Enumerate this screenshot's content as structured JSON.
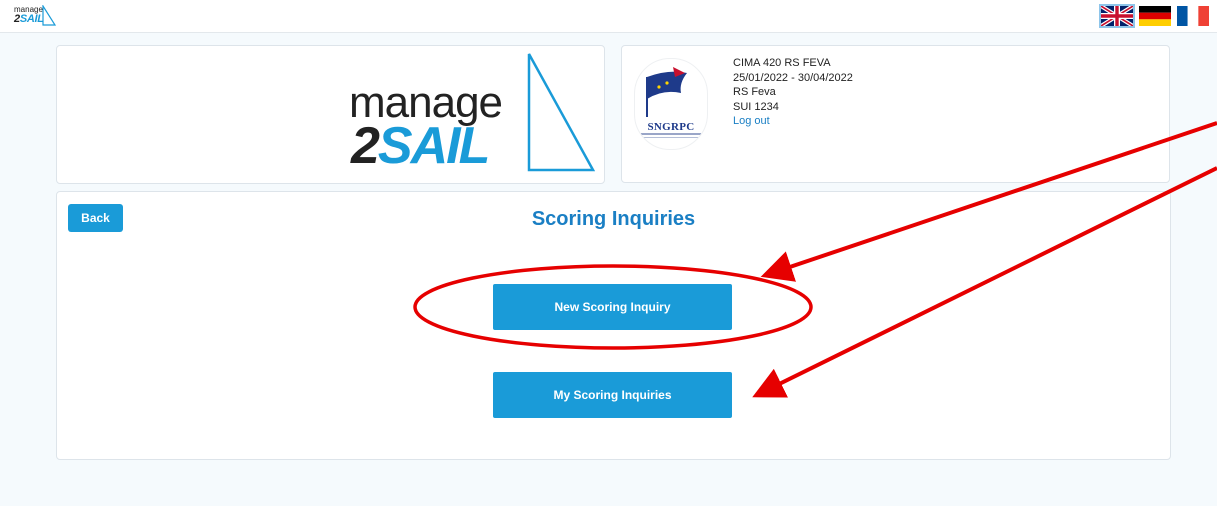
{
  "header": {
    "mini_logo": {
      "line1": "manage",
      "line2_dark": "2",
      "line2_blue": "SAIL"
    },
    "languages": [
      {
        "code": "en",
        "name": "English"
      },
      {
        "code": "de",
        "name": "Deutsch"
      },
      {
        "code": "fr",
        "name": "Français"
      }
    ]
  },
  "brand": {
    "line1": "manage",
    "line2_dark": "2",
    "line2_blue": "SAIL"
  },
  "event": {
    "club_logo_text": "SNGRPC",
    "name": "CIMA 420 RS FEVA",
    "dates": "25/01/2022 - 30/04/2022",
    "class": "RS Feva",
    "sail_number": "SUI 1234",
    "logout_label": "Log out"
  },
  "page": {
    "back_label": "Back",
    "title": "Scoring Inquiries",
    "new_inquiry_label": "New Scoring Inquiry",
    "my_inquiries_label": "My Scoring Inquiries"
  },
  "colors": {
    "accent": "#1a9bd8",
    "title": "#1a7fc4",
    "annotation": "#e60000"
  }
}
